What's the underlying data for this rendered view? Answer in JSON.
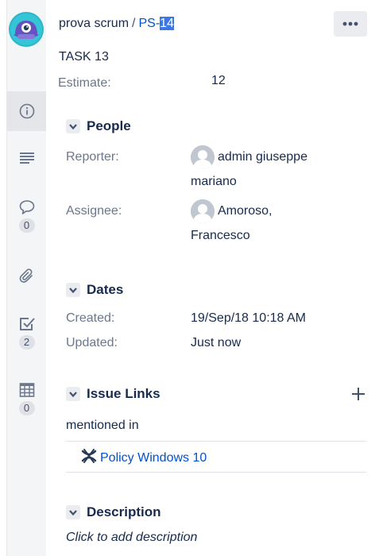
{
  "breadcrumb": {
    "project": "prova scrum",
    "separator": "/",
    "key_prefix": "PS-",
    "key_selected": "14"
  },
  "issue": {
    "summary": "TASK 13",
    "estimate_label": "Estimate:",
    "estimate_value": "12"
  },
  "sidebar": {
    "comments_count": "0",
    "checklist_count": "2",
    "table_count": "0"
  },
  "people": {
    "title": "People",
    "reporter_label": "Reporter:",
    "reporter_name_line1": "admin giuseppe",
    "reporter_name_line2": "mariano",
    "assignee_label": "Assignee:",
    "assignee_name_line1": "Amoroso,",
    "assignee_name_line2": "Francesco"
  },
  "dates": {
    "title": "Dates",
    "created_label": "Created:",
    "created_value": "19/Sep/18 10:18 AM",
    "updated_label": "Updated:",
    "updated_value": "Just now"
  },
  "issue_links": {
    "title": "Issue Links",
    "link_type": "mentioned in",
    "linked_issue": "Policy Windows 10"
  },
  "description": {
    "title": "Description",
    "placeholder": "Click to add description"
  },
  "colors": {
    "link": "#0052cc",
    "text": "#172b4d",
    "label": "#6b778c",
    "sidebar_bg": "#f4f5f7",
    "selection": "#3b78e7"
  }
}
